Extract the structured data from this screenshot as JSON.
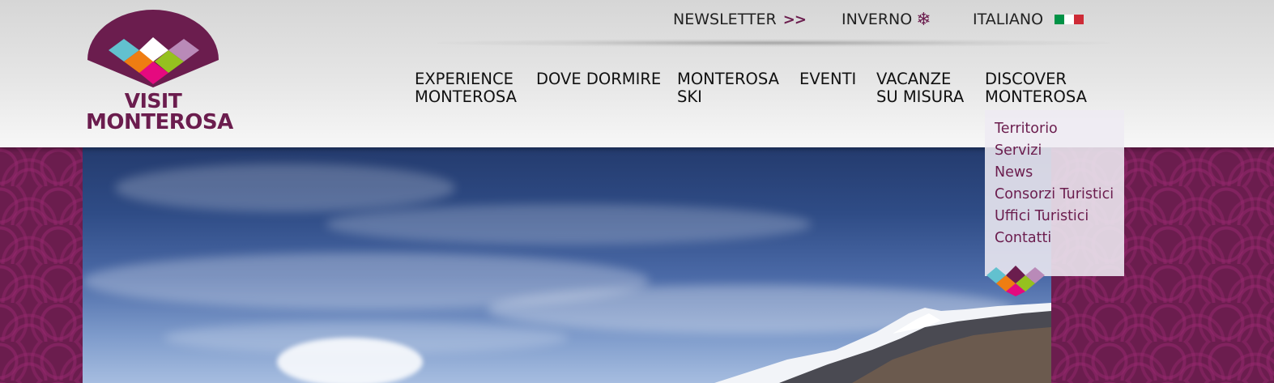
{
  "brand": {
    "line1": "VISIT",
    "line2": "MONTEROSA",
    "color": "#6b1d4e"
  },
  "top_bar": {
    "newsletter": "NEWSLETTER",
    "newsletter_arrow": ">>",
    "season": "INVERNO",
    "season_icon": "snowflake-icon",
    "language": "ITALIANO",
    "language_icon": "italian-flag-icon"
  },
  "nav": {
    "items": [
      {
        "line1": "EXPERIENCE",
        "line2": "MONTEROSA"
      },
      {
        "line1": "DOVE DORMIRE",
        "line2": ""
      },
      {
        "line1": "MONTEROSA",
        "line2": "SKI"
      },
      {
        "line1": "EVENTI",
        "line2": ""
      },
      {
        "line1": "VACANZE",
        "line2": "SU MISURA"
      },
      {
        "line1": "DISCOVER",
        "line2": "MONTEROSA"
      }
    ]
  },
  "dropdown": {
    "items": [
      "Territorio",
      "Servizi",
      "News",
      "Consorzi Turistici",
      "Uffici Turistici",
      "Contatti"
    ]
  },
  "colors": {
    "accent": "#6b1d4e",
    "sky": "#2f4c86"
  }
}
